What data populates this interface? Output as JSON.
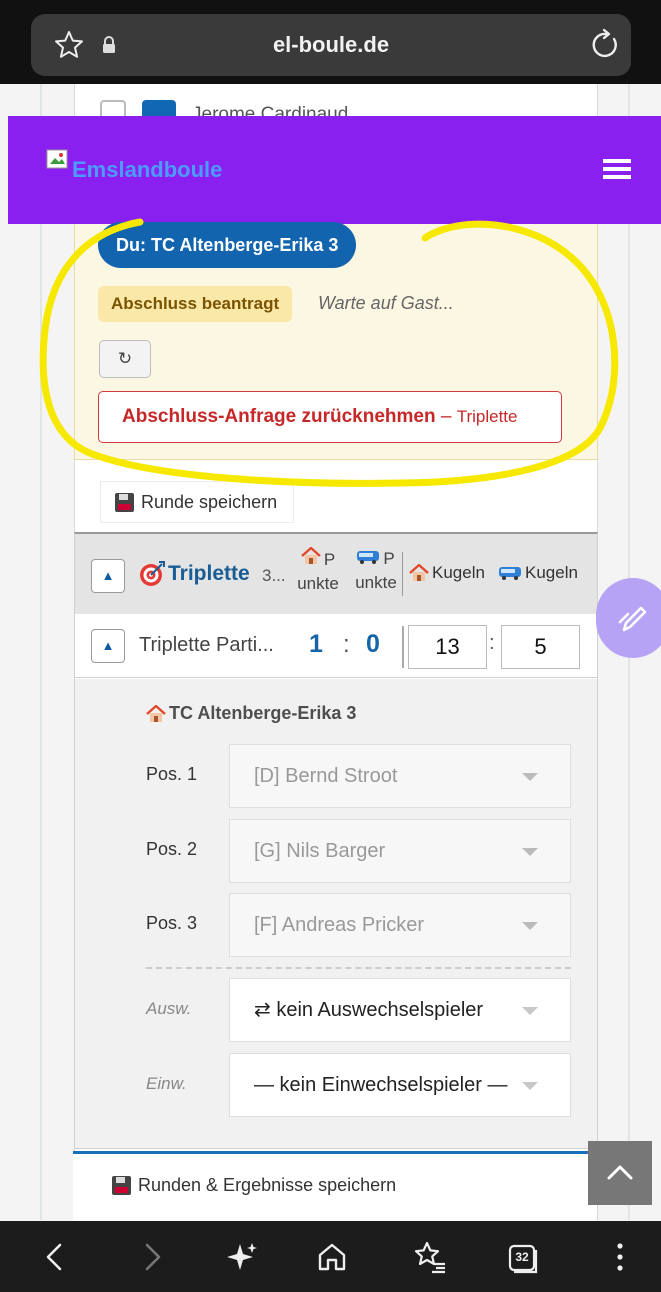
{
  "browser": {
    "url": "el-boule.de",
    "icons": [
      "star-icon",
      "lock-icon",
      "reload-icon"
    ]
  },
  "peek_row": {
    "name": "Jerome Cardinaud"
  },
  "site": {
    "brand": "Emslandboule",
    "header_color": "#8a20f0",
    "menu_icon": "hamburger-menu-icon"
  },
  "status": {
    "you_label": "Du: TC Altenberge-Erika 3",
    "closure_badge": "Abschluss beantragt",
    "wait_text": "Warte auf Gast...",
    "refresh_symbol": "↻",
    "withdraw_label": "Abschluss-Anfrage zurücknehmen",
    "withdraw_sep": " – ",
    "withdraw_sub": "Triplette"
  },
  "save_round_label": "Runde speichern",
  "game": {
    "toggle_symbol": "▲",
    "title": "Triplette",
    "title_ellipsis": "3...",
    "col_home_points": [
      "P",
      "unkte"
    ],
    "col_guest_points": [
      "P",
      "unkte"
    ],
    "col_home_balls": "Kugeln",
    "col_guest_balls": "Kugeln"
  },
  "match": {
    "name": "Triplette Parti...",
    "score_home": "1",
    "score_sep": ":",
    "score_guest": "0",
    "balls_home": "13",
    "balls_sep": ":",
    "balls_guest": "5"
  },
  "lineup": {
    "team": "TC Altenberge-Erika 3",
    "positions": [
      {
        "label": "Pos. 1",
        "player": "[D] Bernd Stroot"
      },
      {
        "label": "Pos. 2",
        "player": "[G] Nils Barger"
      },
      {
        "label": "Pos. 3",
        "player": "[F] Andreas Pricker"
      }
    ],
    "out_label": "Ausw.",
    "out_value": "⇄ kein Auswechselspieler",
    "in_label": "Einw.",
    "in_value": "— kein Einwechselspieler —"
  },
  "save_all_label": "Runden & Ergebnisse speichern",
  "navbar": {
    "tab_count": "32",
    "icons": [
      "back-icon",
      "forward-icon",
      "sparkle-icon",
      "home-icon",
      "bookmarks-icon",
      "tabs-icon",
      "more-icon"
    ]
  },
  "colors": {
    "primary_blue": "#1164ad",
    "danger": "#c62828",
    "annotation": "#f7e800"
  }
}
